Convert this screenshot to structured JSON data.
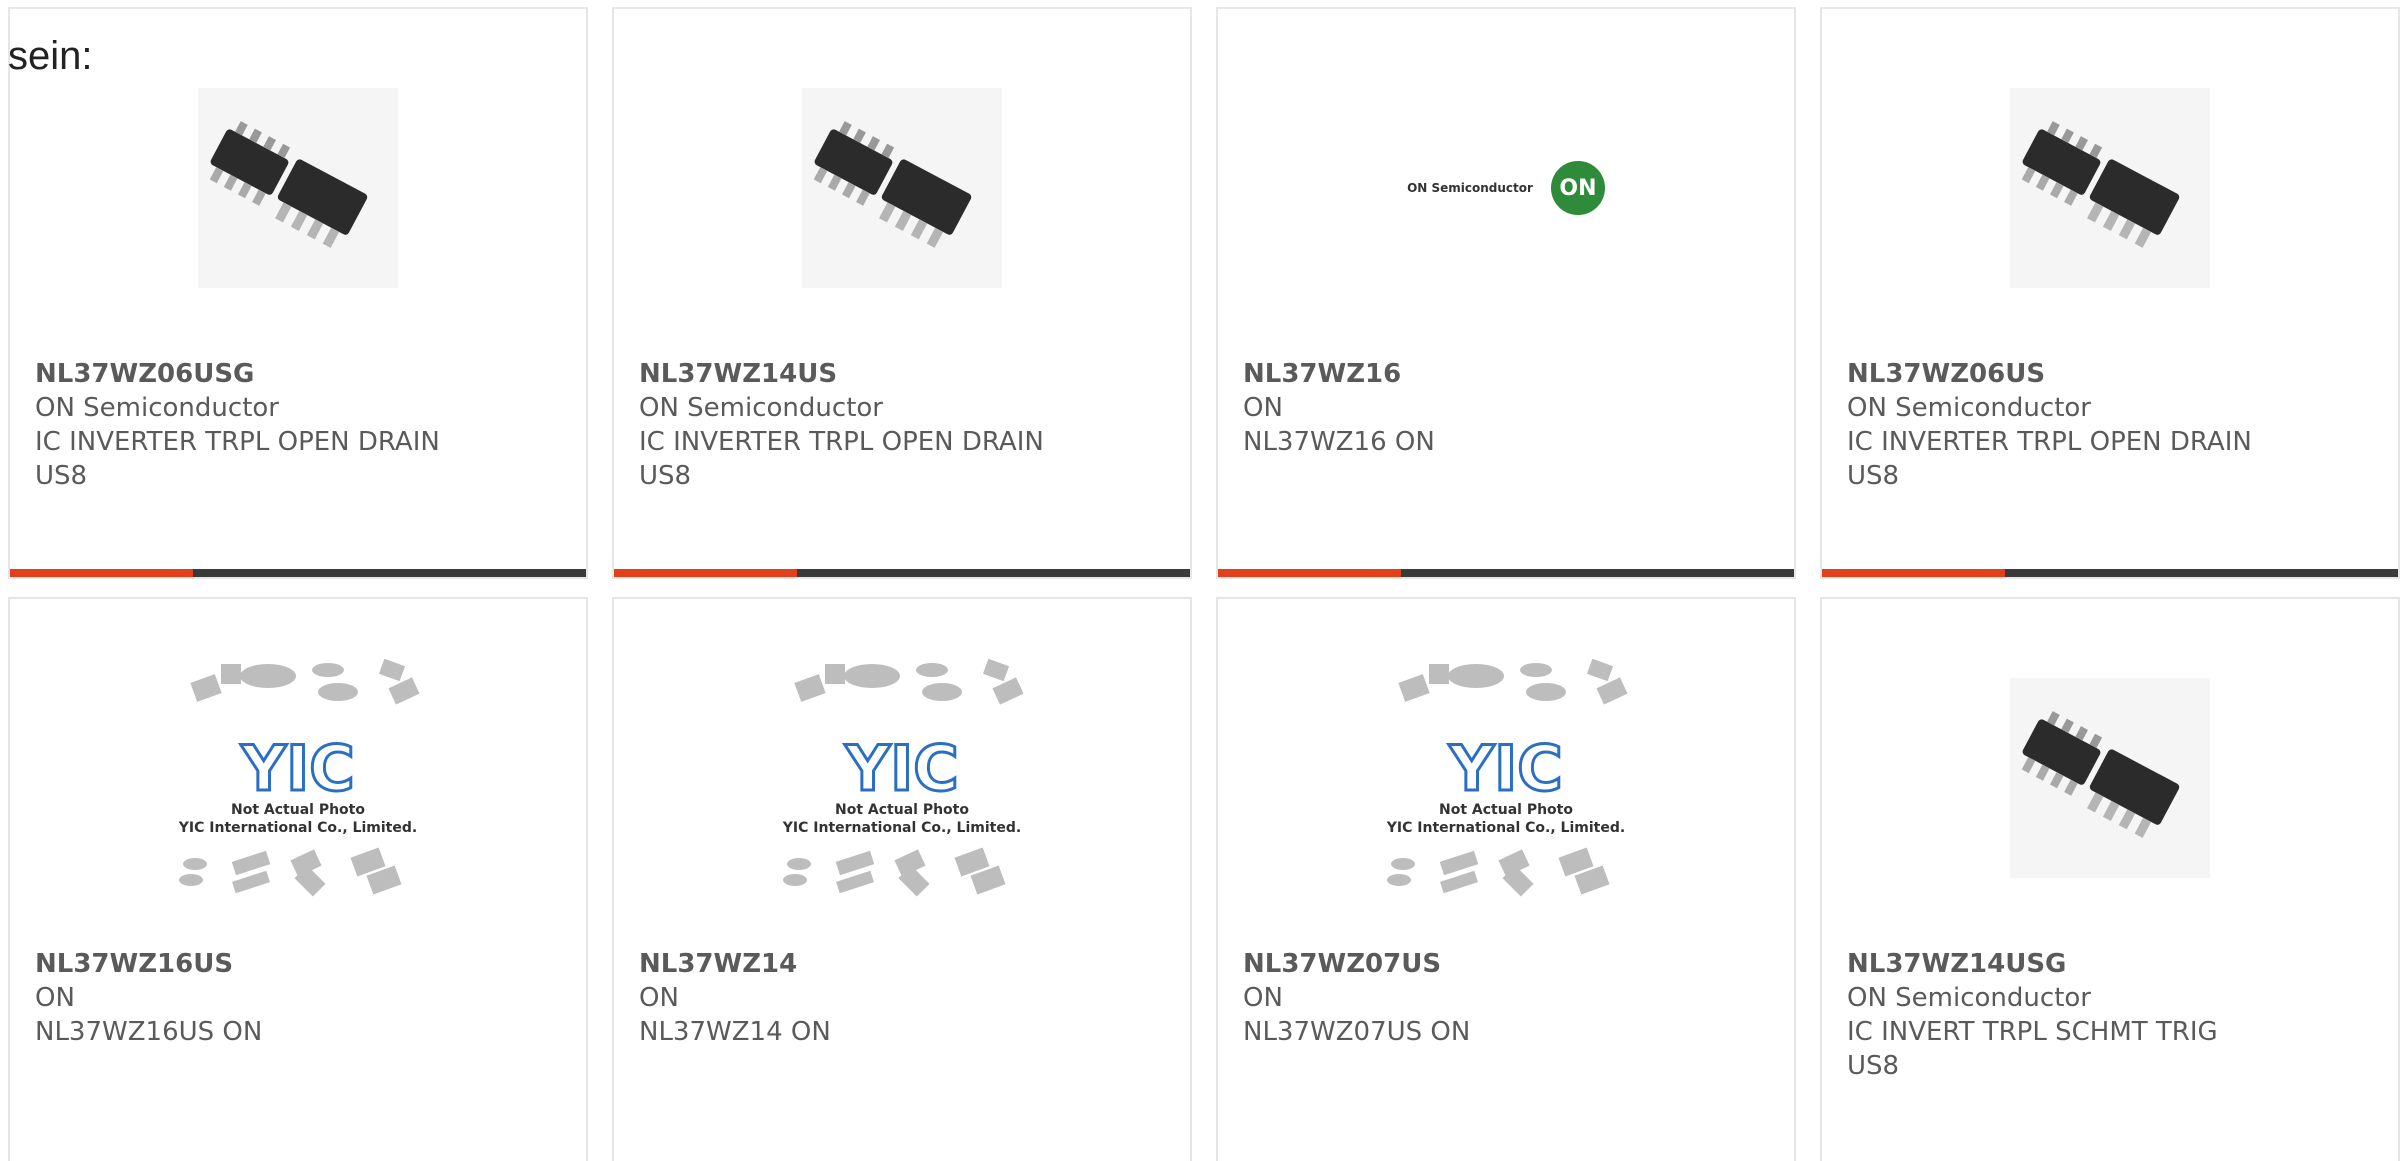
{
  "intro": {
    "text": "sein:"
  },
  "colors": {
    "accent": "#e0401a",
    "bar": "#3a3a3a",
    "text": "#5a5a5a",
    "border": "#e6e6e6"
  },
  "products": [
    {
      "part": "NL37WZ06USG",
      "maker": "ON Semiconductor",
      "desc": "IC INVERTER TRPL OPEN DRAIN US8",
      "image": "ic-chips-photo"
    },
    {
      "part": "NL37WZ14US",
      "maker": "ON Semiconductor",
      "desc": "IC INVERTER TRPL OPEN DRAIN US8",
      "image": "ic-chips-photo"
    },
    {
      "part": "NL37WZ16",
      "maker": "ON",
      "desc": "NL37WZ16 ON",
      "image": "on-semiconductor-logo",
      "logo_text": "ON Semiconductor",
      "logo_badge": "ON"
    },
    {
      "part": "NL37WZ06US",
      "maker": "ON Semiconductor",
      "desc": "IC INVERTER TRPL OPEN DRAIN US8",
      "image": "ic-chips-photo"
    },
    {
      "part": "NL37WZ16US",
      "maker": "ON",
      "desc": "NL37WZ16US ON",
      "image": "yic-placeholder",
      "placeholder_line1": "Not Actual Photo",
      "placeholder_line2": "YIC International Co., Limited.",
      "placeholder_logo": "YIC"
    },
    {
      "part": "NL37WZ14",
      "maker": "ON",
      "desc": "NL37WZ14 ON",
      "image": "yic-placeholder",
      "placeholder_line1": "Not Actual Photo",
      "placeholder_line2": "YIC International Co., Limited.",
      "placeholder_logo": "YIC"
    },
    {
      "part": "NL37WZ07US",
      "maker": "ON",
      "desc": "NL37WZ07US ON",
      "image": "yic-placeholder",
      "placeholder_line1": "Not Actual Photo",
      "placeholder_line2": "YIC International Co., Limited.",
      "placeholder_logo": "YIC"
    },
    {
      "part": "NL37WZ14USG",
      "maker": "ON Semiconductor",
      "desc": "IC INVERT TRPL SCHMT TRIG US8",
      "image": "ic-chips-photo"
    }
  ]
}
